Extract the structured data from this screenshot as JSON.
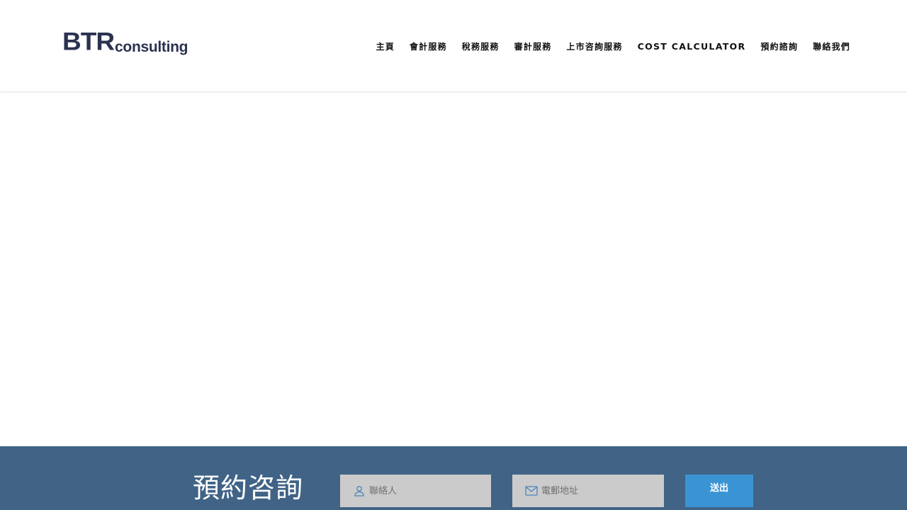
{
  "header": {
    "logo": {
      "main": "BTR",
      "sub": "consulting",
      "color": "#2b3250"
    },
    "nav": [
      {
        "label": "主頁"
      },
      {
        "label": "會計服務"
      },
      {
        "label": "稅務服務"
      },
      {
        "label": "審計服務"
      },
      {
        "label": "上市咨詢服務"
      },
      {
        "label": "COST CALCULATOR"
      },
      {
        "label": "預約諮詢"
      },
      {
        "label": "聯絡我們"
      }
    ]
  },
  "footer": {
    "title": "預約咨詢",
    "name_field": {
      "placeholder": "聯絡人",
      "icon": "user-icon"
    },
    "email_field": {
      "placeholder": "電郵地址",
      "icon": "mail-icon"
    },
    "submit_label": "送出",
    "colors": {
      "bar": "#406386",
      "button": "#3a94d4",
      "field": "#cbcbcb"
    }
  }
}
